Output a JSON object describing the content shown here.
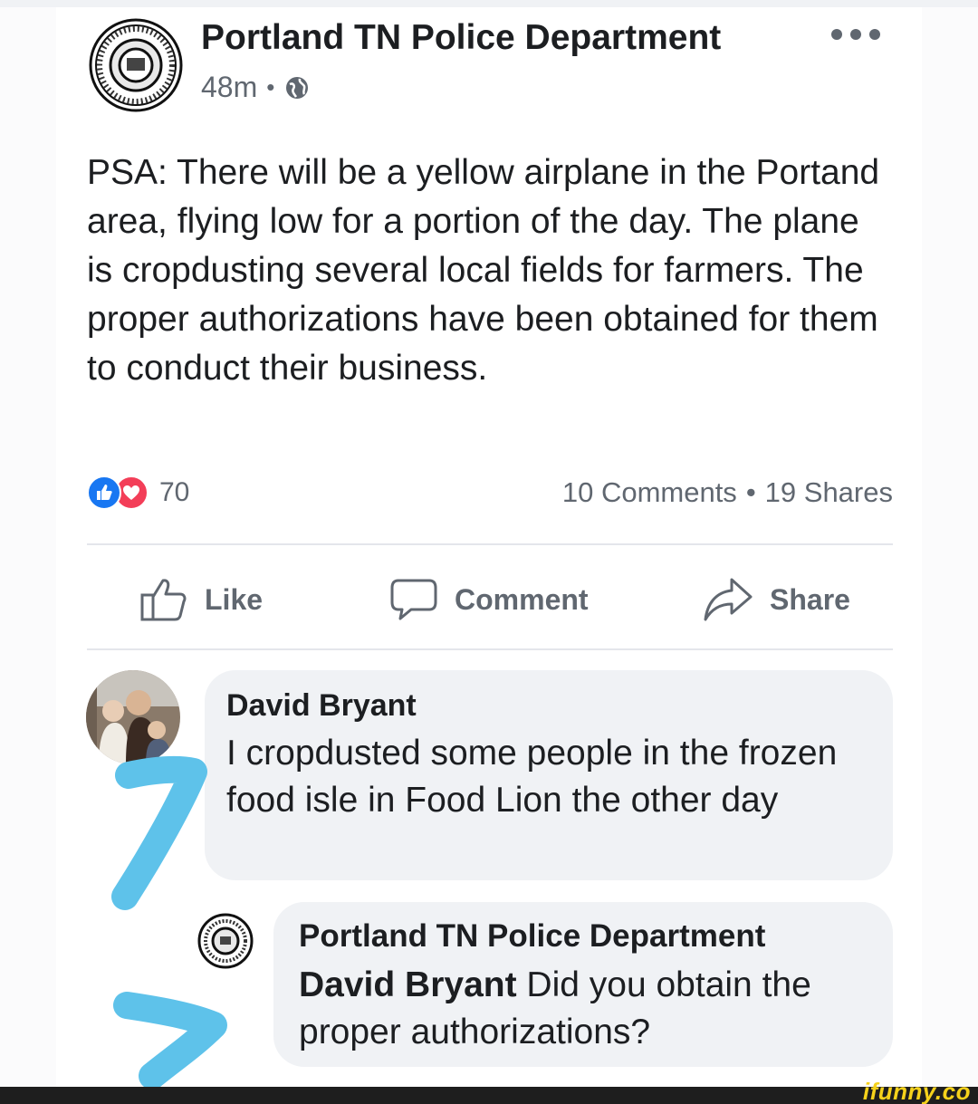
{
  "post": {
    "page_name": "Portland TN Police Department",
    "time": "48m",
    "separator": "•",
    "privacy_icon": "globe-icon",
    "more_icon": "more-options-icon",
    "text": "PSA: There will be a yellow airplane in the Portand area, flying low for a portion of the day. The plane is cropdusting several local fields for farmers. The proper authorizations have been obtained for them to conduct their business."
  },
  "reactions": {
    "count": "70",
    "comments": "10 Comments",
    "dot": "•",
    "shares": "19 Shares",
    "like_color": "#1877f2",
    "love_color": "#f33e58"
  },
  "actions": {
    "like": "Like",
    "comment": "Comment",
    "share": "Share"
  },
  "comments": [
    {
      "author": "David Bryant",
      "text": "I cropdusted some people in the frozen food isle in Food Lion the other day"
    },
    {
      "author": "Portland TN Police Department",
      "mention": "David Bryant",
      "text": " Did you obtain the proper authorizations?"
    }
  ],
  "colors": {
    "bubble": "#f0f2f5",
    "secondary_text": "#606770",
    "annotation_arrow": "#5ec2ea"
  },
  "watermark": "ifunny.co"
}
